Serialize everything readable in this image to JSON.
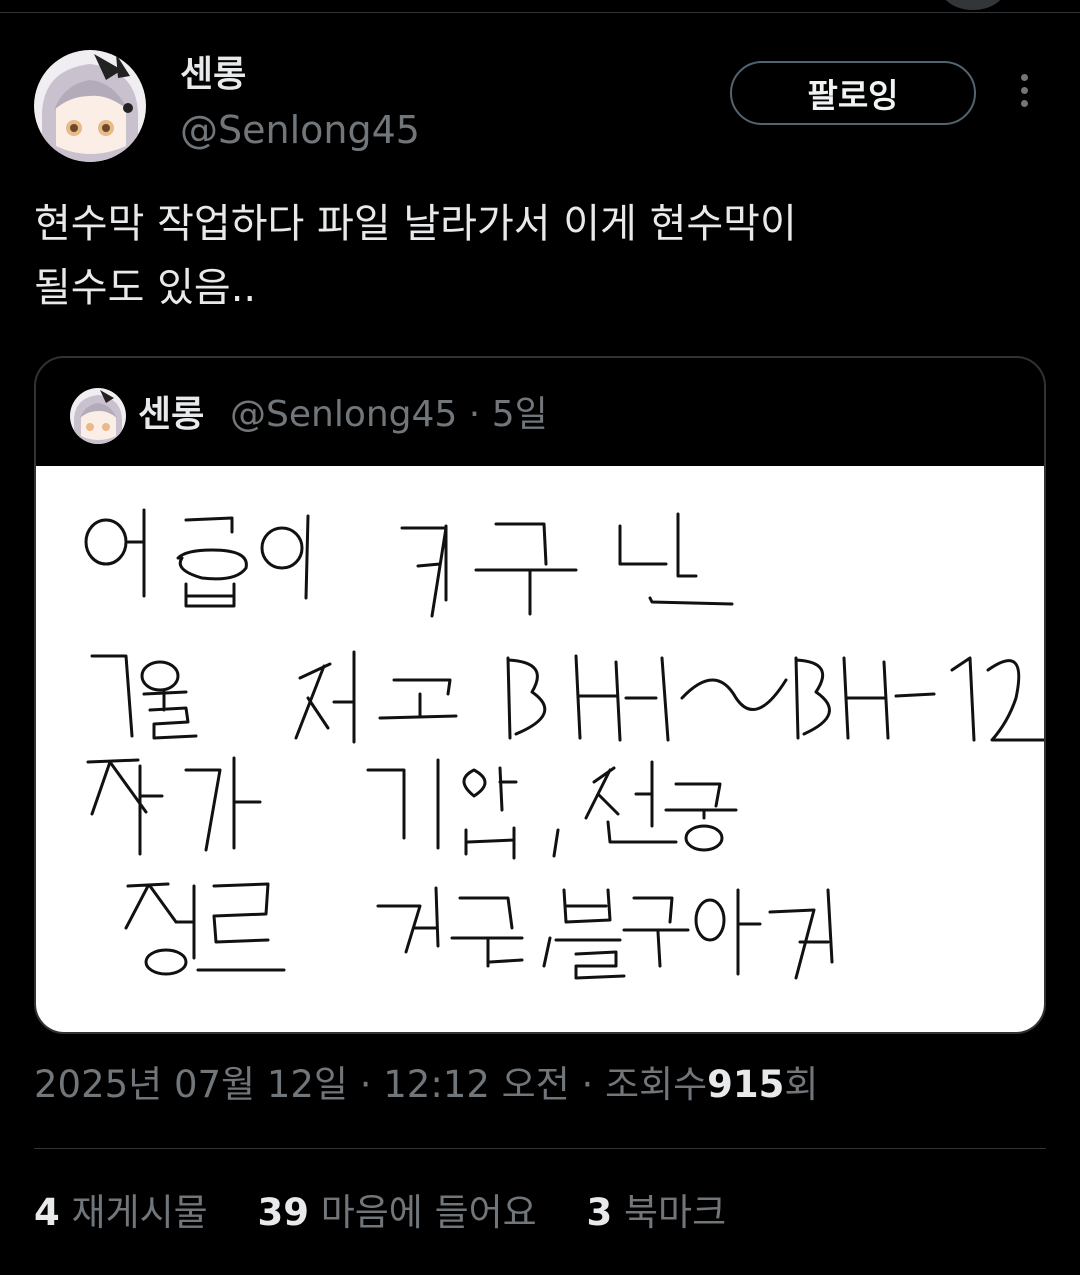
{
  "tweet": {
    "author": {
      "display_name": "센롱",
      "handle": "@Senlong45"
    },
    "follow_button": "팔로잉",
    "text_lines": [
      "현수막 작업하다 파일 날라가서 이게 현수막이",
      "될수도 있음.."
    ],
    "quoted": {
      "display_name": "센롱",
      "handle": "@Senlong45",
      "separator": "·",
      "age": "5일",
      "image_handwritten_lines": [
        "어둠의 카루단",
        "7월 서코 BH-11~BH-12",
        "작가 디앱, 센롱",
        "장르 카루, 블루아카"
      ]
    },
    "timestamp": {
      "date": "2025년 07월 12일",
      "separator": "·",
      "time": "12:12 오전",
      "views_label": "조회수",
      "views_count": "915",
      "views_suffix": "회"
    },
    "stats": [
      {
        "count": "4",
        "label": "재게시물"
      },
      {
        "count": "39",
        "label": "마음에 들어요"
      },
      {
        "count": "3",
        "label": "북마크"
      }
    ]
  },
  "colors": {
    "background": "#000000",
    "text": "#e7e9ea",
    "muted": "#71767b",
    "border": "#2f3336"
  },
  "icons": {
    "more": "more-dots-vertical-icon"
  }
}
